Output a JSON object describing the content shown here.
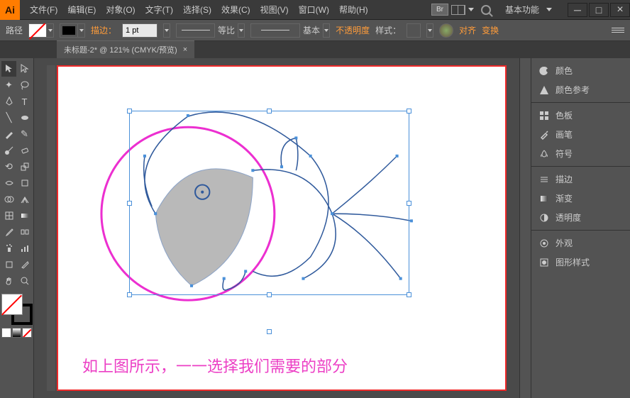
{
  "menu": {
    "file": "文件(F)",
    "edit": "编辑(E)",
    "object": "对象(O)",
    "type": "文字(T)",
    "select": "选择(S)",
    "effect": "效果(C)",
    "view": "视图(V)",
    "window": "窗口(W)",
    "help": "帮助(H)"
  },
  "title": {
    "br": "Br",
    "workspace": "基本功能"
  },
  "options": {
    "tool": "路径",
    "stroke_label": "描边：",
    "stroke_val": "1 pt",
    "profile": "等比",
    "brush": "基本",
    "opacity": "不透明度",
    "style": "样式：",
    "align": "对齐",
    "transform": "变换"
  },
  "doc": {
    "tab": "未标题-2* @ 121% (CMYK/预览)",
    "close": "×"
  },
  "canvas": {
    "caption": "如上图所示，一一选择我们需要的部分"
  },
  "panels": {
    "color": "颜色",
    "color_guide": "颜色参考",
    "swatches": "色板",
    "brushes": "画笔",
    "symbols": "符号",
    "stroke": "描边",
    "gradient": "渐变",
    "transparency": "透明度",
    "appearance": "外观",
    "graphic_styles": "图形样式"
  }
}
